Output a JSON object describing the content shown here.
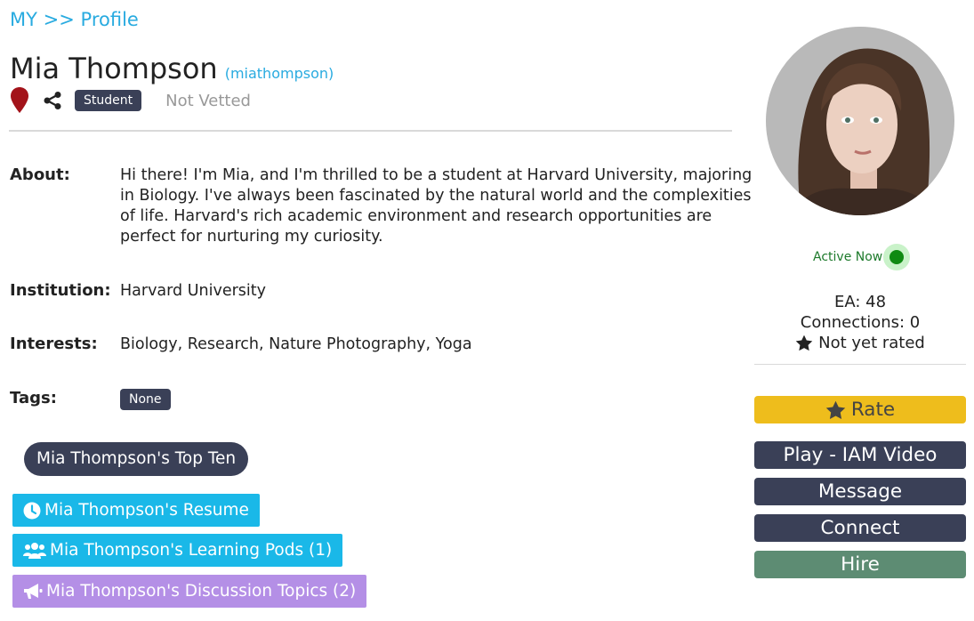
{
  "breadcrumb": {
    "root": "MY",
    "separator": ">>",
    "current": "Profile"
  },
  "profile": {
    "name": "Mia Thompson",
    "username": "(miathompson)",
    "role_badge": "Student",
    "vetted_status": "Not Vetted"
  },
  "fields": {
    "about_label": "About:",
    "about_text": "Hi there! I'm Mia, and I'm thrilled to be a student at Harvard University, majoring in Biology. I've always been fascinated by the natural world and the complexities of life. Harvard's rich academic environment and research opportunities are perfect for nurturing my curiosity.",
    "institution_label": "Institution:",
    "institution_value": "Harvard University",
    "interests_label": "Interests:",
    "interests_value": "Biology, Research, Nature Photography, Yoga",
    "tags_label": "Tags:",
    "tags_value": "None"
  },
  "links": {
    "top_ten": "Mia Thompson's Top Ten",
    "resume": "Mia Thompson's Resume",
    "learning_pods": "Mia Thompson's Learning Pods (1)",
    "discussion_topics": "Mia Thompson's Discussion Topics (2)"
  },
  "sidebar": {
    "status": "Active Now",
    "ea": "EA: 48",
    "connections": "Connections: 0",
    "rating": "Not yet rated",
    "buttons": {
      "rate": "Rate",
      "play_video": "Play - IAM Video",
      "message": "Message",
      "connect": "Connect",
      "hire": "Hire"
    }
  },
  "icons": {
    "location": "map-pin-icon",
    "share": "share-icon",
    "star": "star-icon",
    "clock": "clock-icon",
    "users": "users-icon",
    "megaphone": "megaphone-icon"
  },
  "colors": {
    "link": "#29abe0",
    "dark": "#3a4057",
    "blue_button": "#1ab8e8",
    "purple_button": "#b48fe6",
    "rate_button": "#eebd1c",
    "hire_button": "#5d8c73",
    "active_green": "#0f8a12",
    "pin_red": "#a3131a"
  }
}
